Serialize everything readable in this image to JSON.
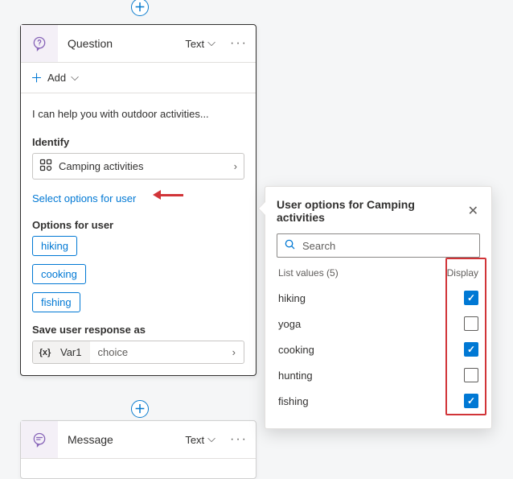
{
  "question_card": {
    "title": "Question",
    "type_label": "Text",
    "add_label": "Add",
    "prompt": "I can help you with outdoor activities...",
    "identify_label": "Identify",
    "identify_value": "Camping activities",
    "select_options_link": "Select options for user",
    "options_label": "Options for user",
    "chips": [
      "hiking",
      "cooking",
      "fishing"
    ],
    "save_label": "Save user response as",
    "var_icon_label": "{x}",
    "var_name": "Var1",
    "var_type": "choice"
  },
  "message_card": {
    "title": "Message",
    "type_label": "Text"
  },
  "popover": {
    "title": "User options for Camping activities",
    "search_placeholder": "Search",
    "list_header": "List values (5)",
    "display_header": "Display",
    "items": [
      {
        "label": "hiking",
        "checked": true
      },
      {
        "label": "yoga",
        "checked": false
      },
      {
        "label": "cooking",
        "checked": true
      },
      {
        "label": "hunting",
        "checked": false
      },
      {
        "label": "fishing",
        "checked": true
      }
    ]
  }
}
